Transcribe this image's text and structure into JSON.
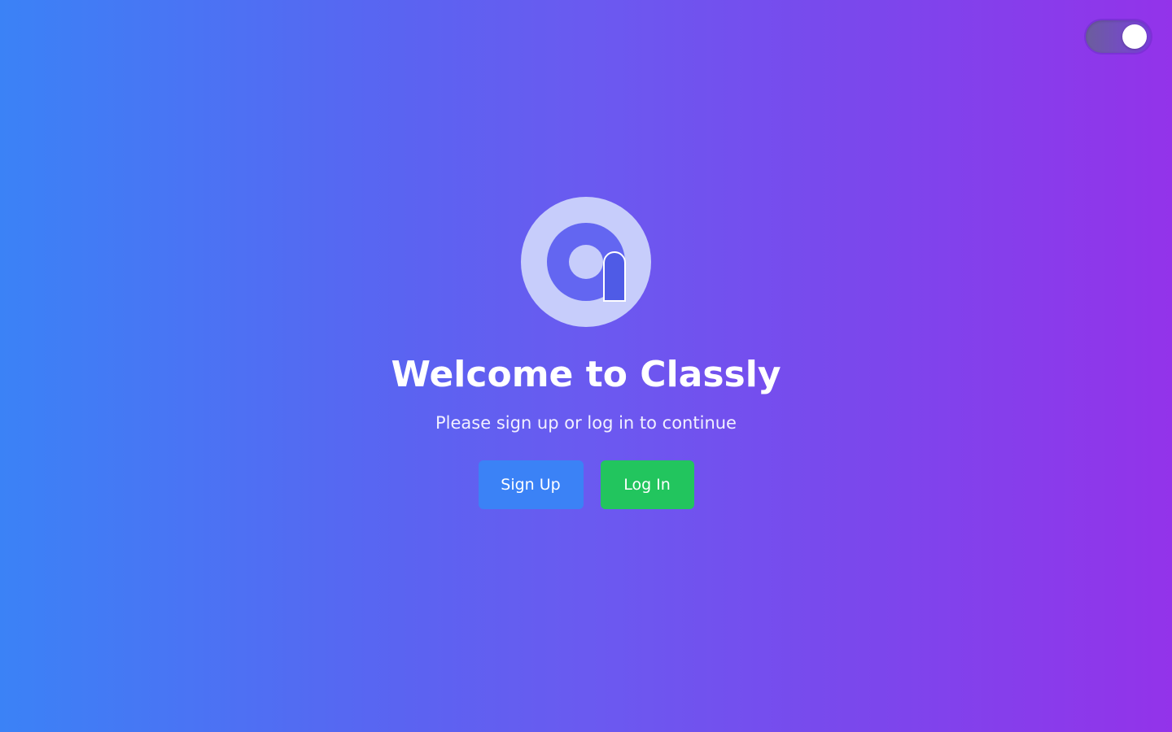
{
  "app": {
    "title": "Welcome to Classly",
    "subtitle": "Please sign up or log in to continue"
  },
  "logo": {
    "icon": "classly-logo",
    "outer_color": "#c7cdfb",
    "inner_color": "#6366f1",
    "dot_color": "#c7cdfb",
    "bar_color": "#4f46e5"
  },
  "theme_toggle": {
    "state": "on"
  },
  "buttons": {
    "signup_label": "Sign Up",
    "login_label": "Log In",
    "signup_color": "#3b82f6",
    "login_color": "#22c55e"
  },
  "colors": {
    "gradient_start": "#3b82f6",
    "gradient_end": "#9333ea"
  }
}
